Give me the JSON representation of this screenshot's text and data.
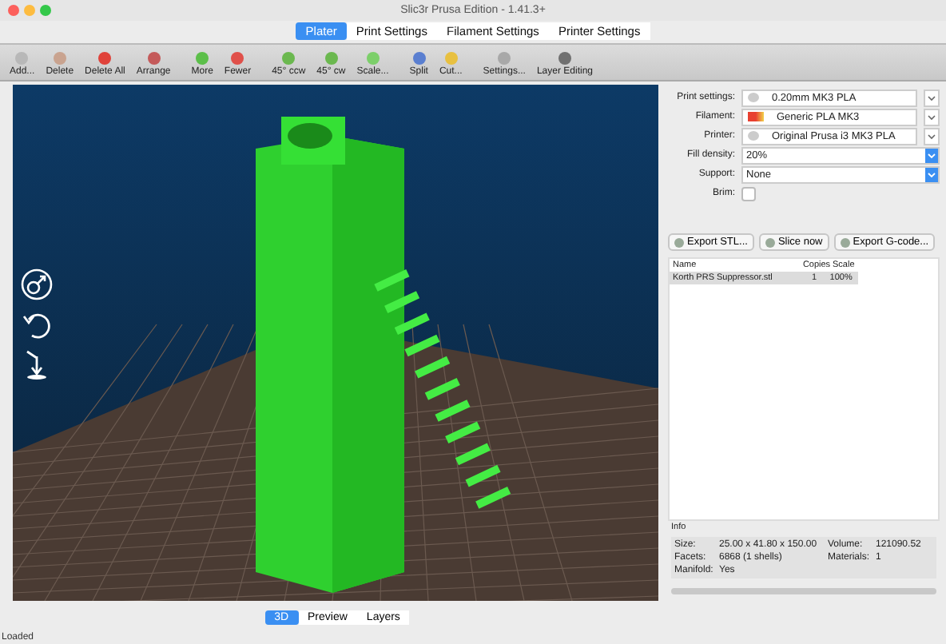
{
  "window": {
    "title": "Slic3r Prusa Edition - 1.41.3+"
  },
  "tabs": [
    {
      "label": "Plater",
      "selected": true
    },
    {
      "label": "Print Settings",
      "selected": false
    },
    {
      "label": "Filament Settings",
      "selected": false
    },
    {
      "label": "Printer Settings",
      "selected": false
    }
  ],
  "toolbar": [
    {
      "label": "Add...",
      "color": "#b8b8b8"
    },
    {
      "label": "Delete",
      "color": "#c9a38f"
    },
    {
      "label": "Delete All",
      "color": "#e0423a"
    },
    {
      "label": "Arrange",
      "color": "#c45a5a"
    },
    {
      "label": "More",
      "color": "#5cbf4a"
    },
    {
      "label": "Fewer",
      "color": "#e0504a"
    },
    {
      "label": "45° ccw",
      "color": "#6bb84f"
    },
    {
      "label": "45° cw",
      "color": "#6bb84f"
    },
    {
      "label": "Scale...",
      "color": "#7ccf6a"
    },
    {
      "label": "Split",
      "color": "#5a7fd0"
    },
    {
      "label": "Cut...",
      "color": "#e8c040"
    },
    {
      "label": "Settings...",
      "color": "#a8a8a8"
    },
    {
      "label": "Layer Editing",
      "color": "#707070"
    }
  ],
  "settings": [
    {
      "kind": "preset",
      "label": "Print settings:",
      "value": "0.20mm MK3 PLA"
    },
    {
      "kind": "preset",
      "label": "Filament:",
      "value": "Generic PLA MK3",
      "color": "#e84030"
    },
    {
      "kind": "preset",
      "label": "Printer:",
      "value": "Original Prusa i3 MK3 PLA"
    },
    {
      "kind": "select",
      "label": "Fill density:",
      "value": "20%"
    },
    {
      "kind": "select",
      "label": "Support:",
      "value": "None"
    },
    {
      "kind": "checkbox",
      "label": "Brim:",
      "checked": false
    }
  ],
  "actions": [
    "Export STL...",
    "Slice now",
    "Export G-code..."
  ],
  "objects": {
    "columns": [
      "Name",
      "Copies",
      "Scale"
    ],
    "rows": [
      {
        "cells": [
          "Korth PRS Suppressor.stl",
          "1",
          "100%"
        ],
        "selected": true
      }
    ]
  },
  "info": {
    "title": "Info",
    "fields": [
      {
        "label": "Size:",
        "value": "25.00 x 41.80 x 150.00"
      },
      {
        "label": "Volume:",
        "value": "121090.52"
      },
      {
        "label": "Facets:",
        "value": "6868 (1 shells)"
      },
      {
        "label": "Materials:",
        "value": "1"
      },
      {
        "label": "Manifold:",
        "value": "Yes"
      }
    ]
  },
  "view_tabs": [
    {
      "label": "3D",
      "selected": true
    },
    {
      "label": "Preview",
      "selected": false
    },
    {
      "label": "Layers",
      "selected": false
    }
  ],
  "status_bar": "Loaded"
}
